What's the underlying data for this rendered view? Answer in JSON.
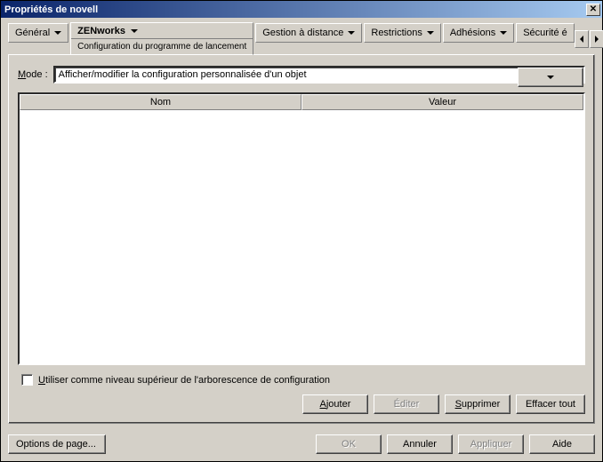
{
  "window": {
    "title": "Propriétés de novell"
  },
  "tabs": {
    "general": "Général",
    "zenworks": {
      "label": "ZENworks",
      "subtitle": "Configuration du programme de lancement"
    },
    "remote": "Gestion à distance",
    "restrictions": "Restrictions",
    "memberships": "Adhésions",
    "security_trunc": "Sécurité é"
  },
  "mode": {
    "label_prefix": "M",
    "label_rest": "ode :",
    "value": "Afficher/modifier la configuration personnalisée d'un objet"
  },
  "table": {
    "col_name": "Nom",
    "col_value": "Valeur"
  },
  "checkbox": {
    "label_prefix": "U",
    "label_rest": "tiliser comme niveau supérieur de l'arborescence de configuration",
    "checked": false
  },
  "panel_buttons": {
    "add_prefix": "A",
    "add_rest": "jouter",
    "edit": "Éditer",
    "delete_prefix": "S",
    "delete_rest": "upprimer",
    "clear": "Effacer tout"
  },
  "footer": {
    "page_options": "Options de page...",
    "ok": "OK",
    "cancel": "Annuler",
    "apply": "Appliquer",
    "help": "Aide"
  }
}
